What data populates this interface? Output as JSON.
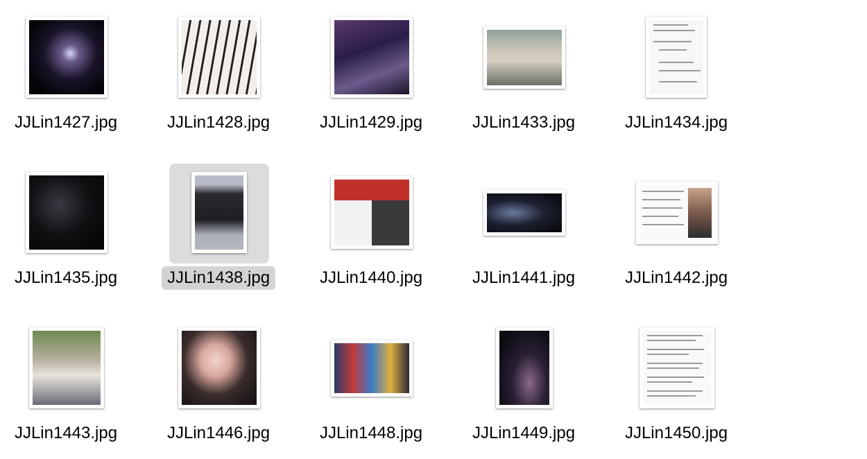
{
  "files": [
    {
      "name": "JJLin1427.jpg",
      "icon": "concert-stage-photo"
    },
    {
      "name": "JJLin1428.jpg",
      "icon": "piano-keys-photo"
    },
    {
      "name": "JJLin1429.jpg",
      "icon": "concert-crowd-photo"
    },
    {
      "name": "JJLin1433.jpg",
      "icon": "fan-banner-photo"
    },
    {
      "name": "JJLin1434.jpg",
      "icon": "chat-screenshot"
    },
    {
      "name": "JJLin1435.jpg",
      "icon": "dark-performance-photo"
    },
    {
      "name": "JJLin1438.jpg",
      "icon": "portrait-photo",
      "selected": true
    },
    {
      "name": "JJLin1440.jpg",
      "icon": "app-screenshot"
    },
    {
      "name": "JJLin1441.jpg",
      "icon": "album-banner"
    },
    {
      "name": "JJLin1442.jpg",
      "icon": "article-screenshot"
    },
    {
      "name": "JJLin1443.jpg",
      "icon": "flowers-tree-photo"
    },
    {
      "name": "JJLin1446.jpg",
      "icon": "selfie-photo"
    },
    {
      "name": "JJLin1448.jpg",
      "icon": "arcade-photo"
    },
    {
      "name": "JJLin1449.jpg",
      "icon": "stage-performer-photo"
    },
    {
      "name": "JJLin1450.jpg",
      "icon": "text-document-screenshot"
    }
  ],
  "colors": {
    "selection_bg": "#dcdcdc",
    "label_selection": "#d3d3d3"
  }
}
